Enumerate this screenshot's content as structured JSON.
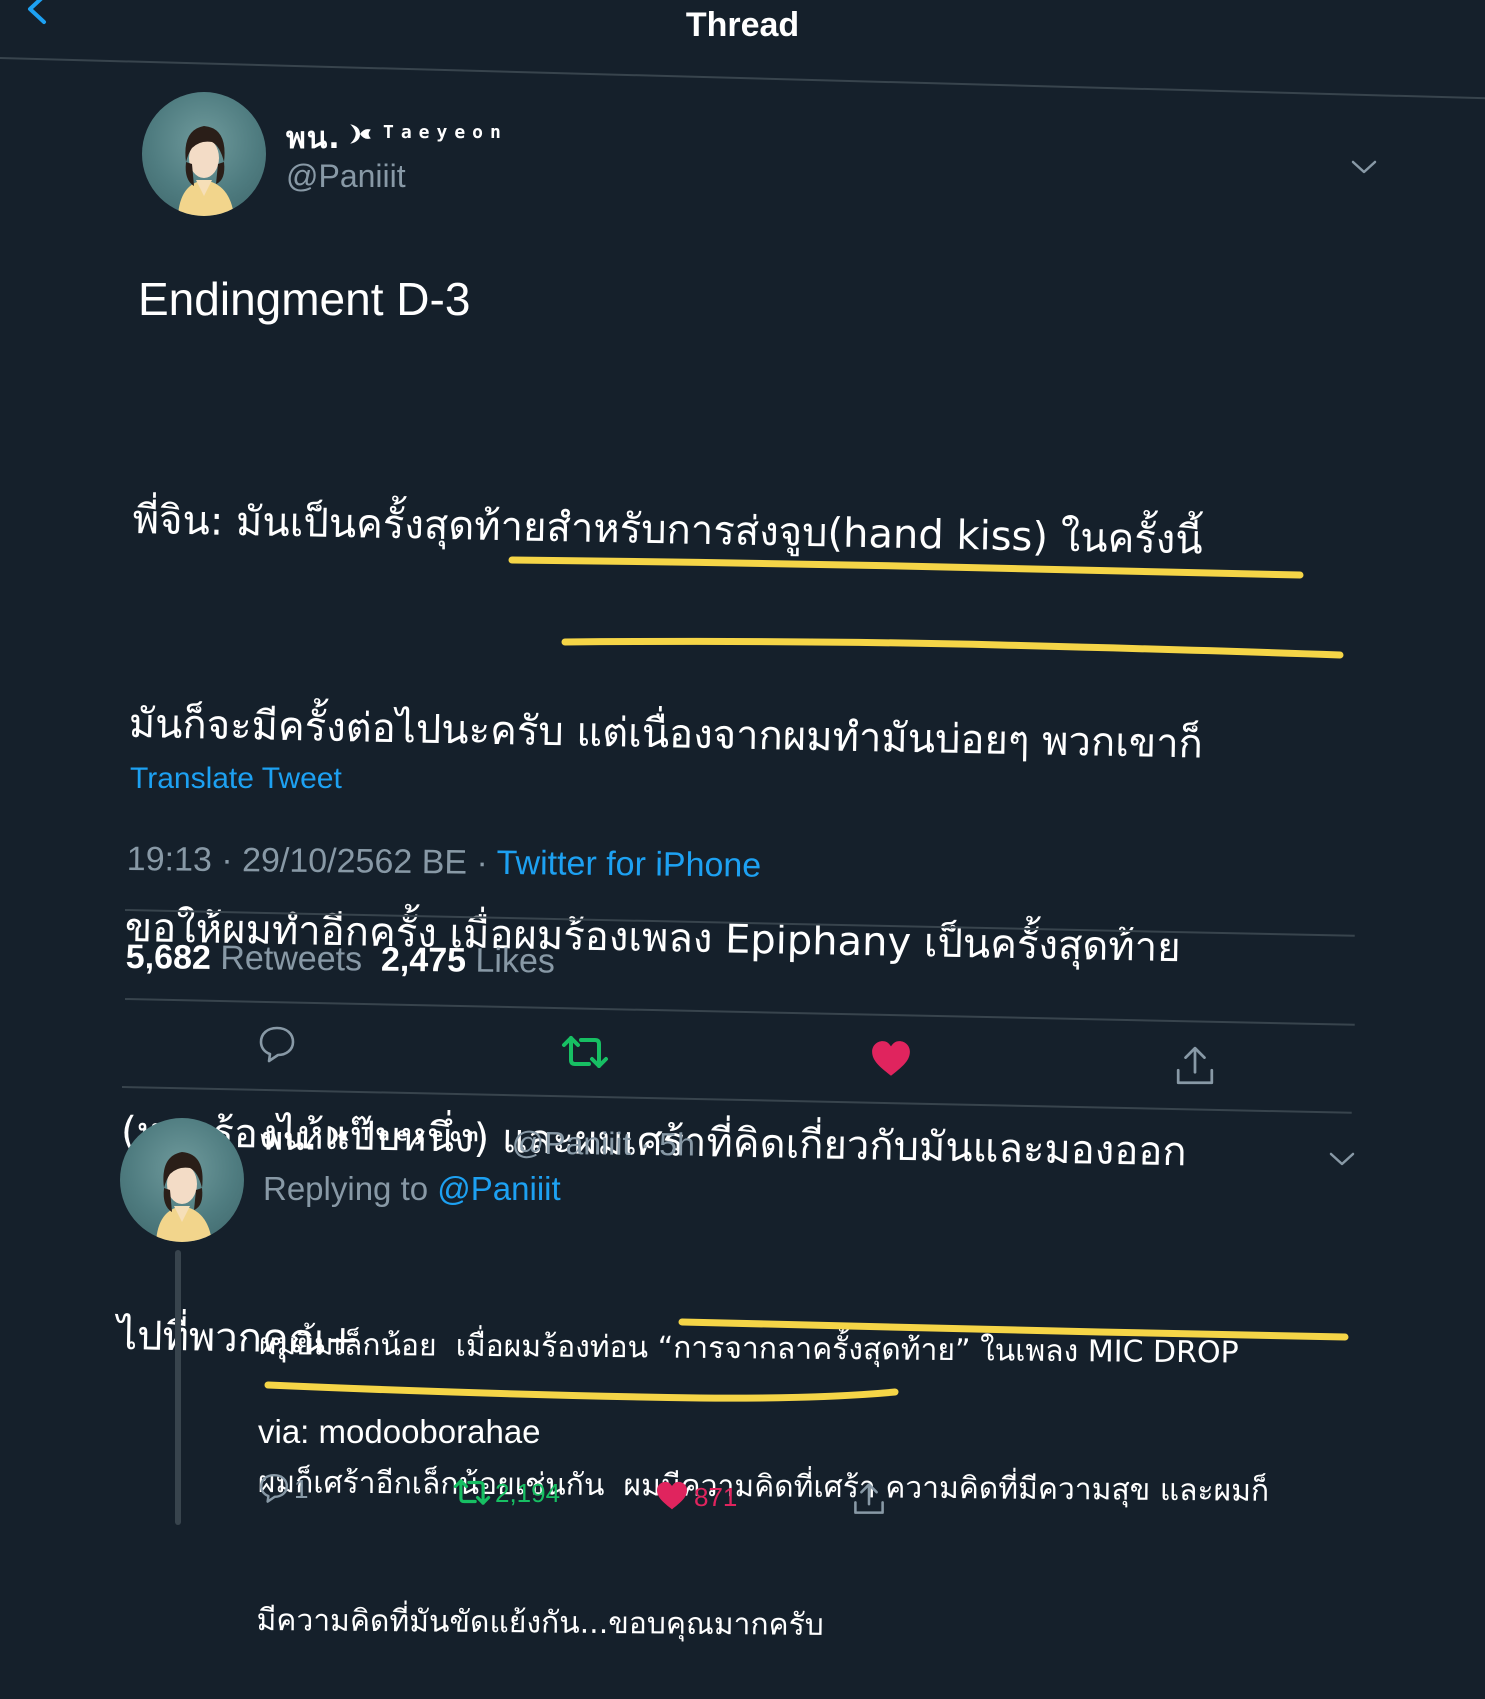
{
  "header": {
    "title": "Thread"
  },
  "main_tweet": {
    "author": {
      "name_thai": "พน.",
      "name_latin": "Taeyeon",
      "handle": "@Paniiit"
    },
    "title": "Endingment D-3",
    "body_lines": [
      "พี่จิน: มันเป็นครั้งสุดท้ายสำหรับการส่งจูบ(hand kiss) ในครั้งนี้",
      "มันก็จะมีครั้งต่อไปนะครับ แต่เนื่องจากผมทำมันบ่อยๆ พวกเขาก็",
      "ขอให้ผมทำอีกครั้ง เมื่อผมร้องเพลง Epiphany เป็นครั้งสุดท้าย",
      "(หยุดร้องไห้แป๊บหนึ่ง) และผมเศร้าที่คิดเกี่ยวกับมันและมองออก",
      "ไปที่พวกคุณ+"
    ],
    "translate_label": "Translate Tweet",
    "time": "19:13 · 29/10/2562 BE · ",
    "source": "Twitter for iPhone",
    "retweets_count": "5,682",
    "retweets_label": "Retweets",
    "likes_count": "2,475",
    "likes_label": "Likes",
    "icons": [
      "reply-icon",
      "retweet-icon",
      "heart-icon",
      "share-icon"
    ],
    "colors": {
      "retweet": "#17bf63",
      "like": "#e0245e",
      "link": "#1da1f2"
    }
  },
  "reply_tweet": {
    "author": {
      "name_thai": "พน.",
      "name_latin": "Taeyeon",
      "handle": "@Paniiit",
      "time": "· 5h"
    },
    "replying_prefix": "Replying to ",
    "replying_handle": "@Paniiit",
    "body_lines": [
      "ผมยิ้มเล็กน้อย  เมื่อผมร้องท่อน “การจากลาครั้งสุดท้าย” ในเพลง MIC DROP",
      "ผมก็เศร้าอีกเล็กน้อยเช่นกัน  ผมมีความคิดที่เศร้า ความคิดที่มีความสุข และผมก็",
      "มีความคิดที่มันขัดแย้งกัน...ขอบคุณมากครับ"
    ],
    "via": "via: modooborahae",
    "reply_count": "1",
    "retweet_count": "2,194",
    "like_count": "871"
  },
  "highlight_color": "#f5d547"
}
